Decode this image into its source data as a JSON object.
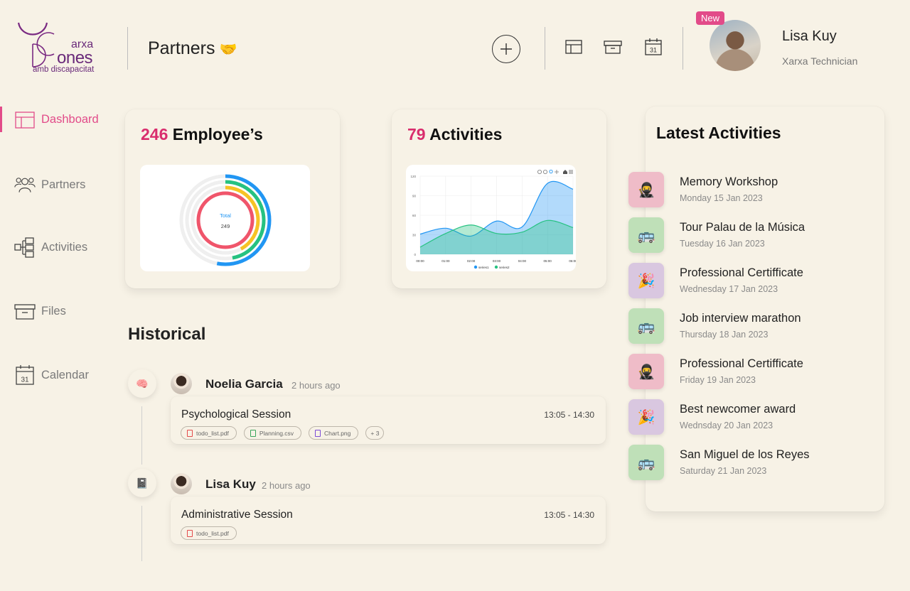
{
  "logo": {
    "line1": "arxa",
    "line2": "ones",
    "line3": "amb discapacitat"
  },
  "header": {
    "title": "Partners",
    "title_emoji": "🤝",
    "add_icon": "plus-icon",
    "icons": [
      "layout-icon",
      "archive-icon",
      "calendar-icon"
    ],
    "calendar_day": "31"
  },
  "user": {
    "badge": "New",
    "name": "Lisa Kuy",
    "role": "Xarxa Technician"
  },
  "sidebar": {
    "items": [
      {
        "label": "Dashboard",
        "icon": "layout-icon",
        "active": true
      },
      {
        "label": "Partners",
        "icon": "users-icon",
        "active": false
      },
      {
        "label": "Activities",
        "icon": "hierarchy-icon",
        "active": false
      },
      {
        "label": "Files",
        "icon": "archive-icon",
        "active": false
      },
      {
        "label": "Calendar",
        "icon": "calendar-icon",
        "active": false
      }
    ]
  },
  "employees": {
    "count": "246",
    "label": "Employee’s",
    "donut_label": "Total",
    "donut_value": "249"
  },
  "activities": {
    "count": "79",
    "label": "Activities"
  },
  "chart_data": [
    {
      "type": "pie",
      "title": "",
      "center_label": "Total",
      "center_value": "249",
      "series": [
        {
          "color": "#2196f3",
          "fraction": 0.53
        },
        {
          "color": "#26c281",
          "fraction": 0.47
        },
        {
          "color": "#f7c325",
          "fraction": 0.42
        },
        {
          "color": "#f0556b",
          "fraction": 1.0
        }
      ]
    },
    {
      "type": "area",
      "title": "",
      "x": [
        "00:00",
        "01:00",
        "02:00",
        "03:00",
        "04:00",
        "05:00",
        "06:00"
      ],
      "ylim": [
        0,
        120
      ],
      "yticks": [
        "0",
        "30",
        "60",
        "90",
        "120"
      ],
      "series": [
        {
          "name": "series1",
          "color": "#2196f3",
          "values": [
            31,
            40,
            28,
            51,
            42,
            109,
            100
          ]
        },
        {
          "name": "series2",
          "color": "#26c281",
          "values": [
            11,
            32,
            45,
            32,
            34,
            52,
            41
          ]
        }
      ],
      "legend": "bottom"
    }
  ],
  "historical": {
    "title": "Historical",
    "entries": [
      {
        "bubble_icon": "brain-icon",
        "bubble": "🧠",
        "name": "Noelia Garcia",
        "time": "2 hours ago",
        "session": "Psychological Session",
        "range": "13:05 - 14:30",
        "files": [
          {
            "name": "todo_list.pdf",
            "color": "#e34b4b"
          },
          {
            "name": "Planning.csv",
            "color": "#3aa55b"
          },
          {
            "name": "Chart.png",
            "color": "#7b4bd6"
          }
        ],
        "more": "+ 3"
      },
      {
        "bubble_icon": "notebook-icon",
        "bubble": "📓",
        "name": "Lisa Kuy",
        "time": "2 hours ago",
        "session": "Administrative Session",
        "range": "13:05 - 14:30",
        "files": [
          {
            "name": "todo_list.pdf",
            "color": "#e34b4b"
          }
        ]
      }
    ]
  },
  "latest": {
    "title": "Latest Activities",
    "items": [
      {
        "title": "Memory Workshop",
        "date": "Monday 15  Jan 2023",
        "emoji": "🥷",
        "bg": "#efbcc8",
        "icon": "ninja-icon"
      },
      {
        "title": "Tour Palau de la Música",
        "date": "Tuesday 16  Jan 2023",
        "emoji": "🚌",
        "bg": "#bfe0b8",
        "icon": "bus-icon"
      },
      {
        "title": "Professional Certifficate",
        "date": "Wednesday 17  Jan 2023",
        "emoji": "🎉",
        "bg": "#d9c7e0",
        "icon": "party-icon"
      },
      {
        "title": "Job interview marathon",
        "date": "Thursday 18  Jan 2023",
        "emoji": "🚌",
        "bg": "#bfe0b8",
        "icon": "bus-icon"
      },
      {
        "title": "Professional Certifficate",
        "date": "Friday 19  Jan 2023",
        "emoji": "🥷",
        "bg": "#efbcc8",
        "icon": "ninja-icon"
      },
      {
        "title": "Best newcomer award",
        "date": "Wednsday 20  Jan 2023",
        "emoji": "🎉",
        "bg": "#d9c7e0",
        "icon": "party-icon"
      },
      {
        "title": "San Miguel de los Reyes",
        "date": "Saturday 21  Jan 2023",
        "emoji": "🚌",
        "bg": "#bfe0b8",
        "icon": "bus-icon"
      }
    ]
  }
}
